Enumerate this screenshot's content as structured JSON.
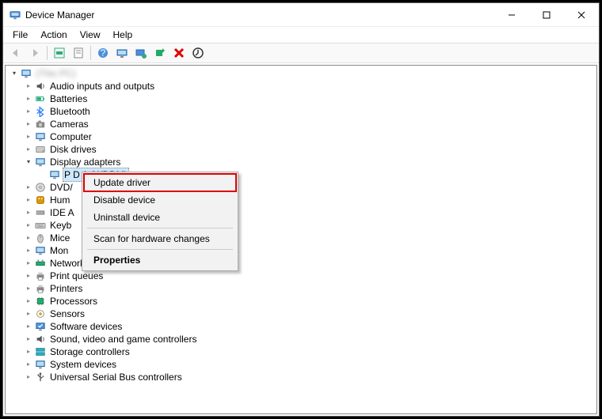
{
  "window": {
    "title": "Device Manager"
  },
  "menu": {
    "file": "File",
    "action": "Action",
    "view": "View",
    "help": "Help"
  },
  "toolbar": {
    "back": "back",
    "forward": "forward",
    "show_hidden": "show-hidden",
    "help": "help",
    "scan": "scan-hardware",
    "properties": "properties",
    "update": "update-driver",
    "enable": "enable-device",
    "uninstall": "uninstall-device",
    "install_legacy": "install-legacy"
  },
  "root_name": "(This PC)",
  "categories": [
    {
      "icon": "audio",
      "label": "Audio inputs and outputs"
    },
    {
      "icon": "battery",
      "label": "Batteries"
    },
    {
      "icon": "bluetooth",
      "label": "Bluetooth"
    },
    {
      "icon": "camera",
      "label": "Cameras"
    },
    {
      "icon": "computer",
      "label": "Computer"
    },
    {
      "icon": "disk",
      "label": "Disk drives"
    },
    {
      "icon": "display",
      "label": "Display adapters",
      "expanded": true,
      "children": [
        {
          "icon": "display",
          "label": "P         D         A         (WDDM)",
          "selected": true
        }
      ]
    },
    {
      "icon": "dvd",
      "label": "DVD/"
    },
    {
      "icon": "hid",
      "label": "Hum"
    },
    {
      "icon": "ide",
      "label": "IDE A"
    },
    {
      "icon": "keyboard",
      "label": "Keyb"
    },
    {
      "icon": "mouse",
      "label": "Mice"
    },
    {
      "icon": "monitor",
      "label": "Mon"
    },
    {
      "icon": "network",
      "label": "Network adapters"
    },
    {
      "icon": "printer",
      "label": "Print queues"
    },
    {
      "icon": "printer",
      "label": "Printers"
    },
    {
      "icon": "processor",
      "label": "Processors"
    },
    {
      "icon": "sensor",
      "label": "Sensors"
    },
    {
      "icon": "software",
      "label": "Software devices"
    },
    {
      "icon": "sound",
      "label": "Sound, video and game controllers"
    },
    {
      "icon": "storage",
      "label": "Storage controllers"
    },
    {
      "icon": "system",
      "label": "System devices"
    },
    {
      "icon": "usb",
      "label": "Universal Serial Bus controllers"
    }
  ],
  "context_menu": {
    "update_driver": "Update driver",
    "disable_device": "Disable device",
    "uninstall_device": "Uninstall device",
    "scan_hardware": "Scan for hardware changes",
    "properties": "Properties"
  }
}
